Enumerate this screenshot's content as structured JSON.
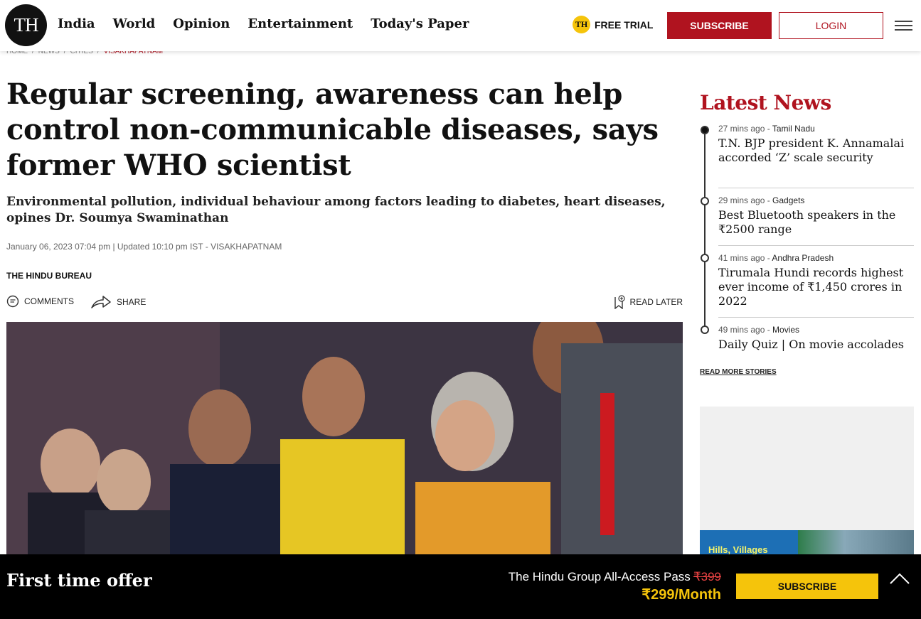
{
  "header": {
    "logo_text": "TH",
    "nav": [
      "India",
      "World",
      "Opinion",
      "Entertainment",
      "Today's Paper"
    ],
    "trial_badge": "TH",
    "trial_label": "FREE TRIAL",
    "subscribe_label": "SUBSCRIBE",
    "login_label": "LOGIN"
  },
  "breadcrumb": {
    "items": [
      "HOME",
      "/",
      "NEWS",
      "/",
      "CITIES",
      "/"
    ],
    "current": "VISAKHAPATNAM"
  },
  "article": {
    "headline": "Regular screening, awareness can help control non-communicable diseases, says former WHO scientist",
    "subhead": "Environmental pollution, individual behaviour among factors leading to diabetes, heart diseases, opines Dr. Soumya Swaminathan",
    "dateline": "January 06, 2023 07:04 pm | Updated 10:10 pm IST - VISAKHAPATNAM",
    "byline": "THE HINDU BUREAU",
    "comments_label": "COMMENTS",
    "share_label": "SHARE",
    "read_later_label": "READ LATER"
  },
  "sidebar": {
    "title": "Latest News",
    "stories": [
      {
        "time": "27 mins ago",
        "section": "Tamil Nadu",
        "title": "T.N. BJP president K. Annamalai accorded ‘Z’ scale security"
      },
      {
        "time": "29 mins ago",
        "section": "Gadgets",
        "title": "Best Bluetooth speakers in the ₹2500 range"
      },
      {
        "time": "41 mins ago",
        "section": "Andhra Pradesh",
        "title": "Tirumala Hundi records highest ever income of ₹1,450 crores in 2022"
      },
      {
        "time": "49 mins ago",
        "section": "Movies",
        "title": "Daily Quiz | On movie accolades"
      }
    ],
    "read_more": "READ MORE STORIES",
    "ad_text": "Hills, Villages"
  },
  "offer": {
    "title": "First time offer",
    "pass_label": "The Hindu Group All-Access Pass",
    "old_price": "₹399",
    "price": "₹299/Month",
    "button": "SUBSCRIBE"
  },
  "colors": {
    "brand_red": "#b0131f",
    "accent_yellow": "#f5c40b"
  }
}
